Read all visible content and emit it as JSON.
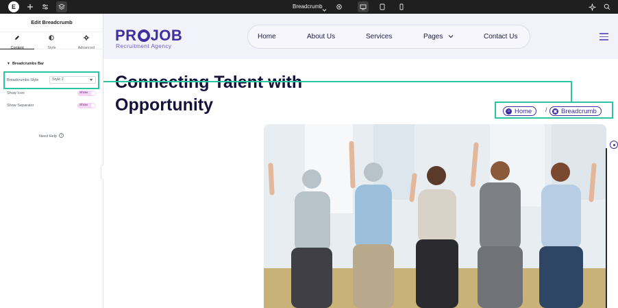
{
  "topbar": {
    "logo": "E",
    "document_name": "Breadcrumb"
  },
  "panel": {
    "title": "Edit Breadcrumb",
    "tabs": [
      {
        "label": "Content",
        "icon": "pencil-icon",
        "active": true
      },
      {
        "label": "Style",
        "icon": "half-circle-icon",
        "active": false
      },
      {
        "label": "Advanced",
        "icon": "gear-icon",
        "active": false
      }
    ],
    "section_title": "Breadcrumbs Bar",
    "controls": {
      "style_label": "Breadcrumbs Style",
      "style_value": "Style 2",
      "show_icon_label": "Show Icon",
      "show_icon_value": "Show",
      "show_separator_label": "Show Separator",
      "show_separator_value": "Show"
    },
    "need_help": "Need Help"
  },
  "site": {
    "logo_before": "PR",
    "logo_after": "JOB",
    "logo_sub": "Recruitment Agency",
    "nav": [
      "Home",
      "About Us",
      "Services",
      "Pages",
      "Contact Us"
    ],
    "hero_title_line1": "Connecting Talent with",
    "hero_title_line2": "Opportunity",
    "breadcrumb": {
      "home": "Home",
      "separator": "/",
      "current": "Breadcrumb"
    }
  },
  "colors": {
    "brand": "#3d2fa0",
    "highlight": "#2bc4a3",
    "toggle_bg": "#f2d6f3",
    "topbar_bg": "#1f1f1f"
  }
}
